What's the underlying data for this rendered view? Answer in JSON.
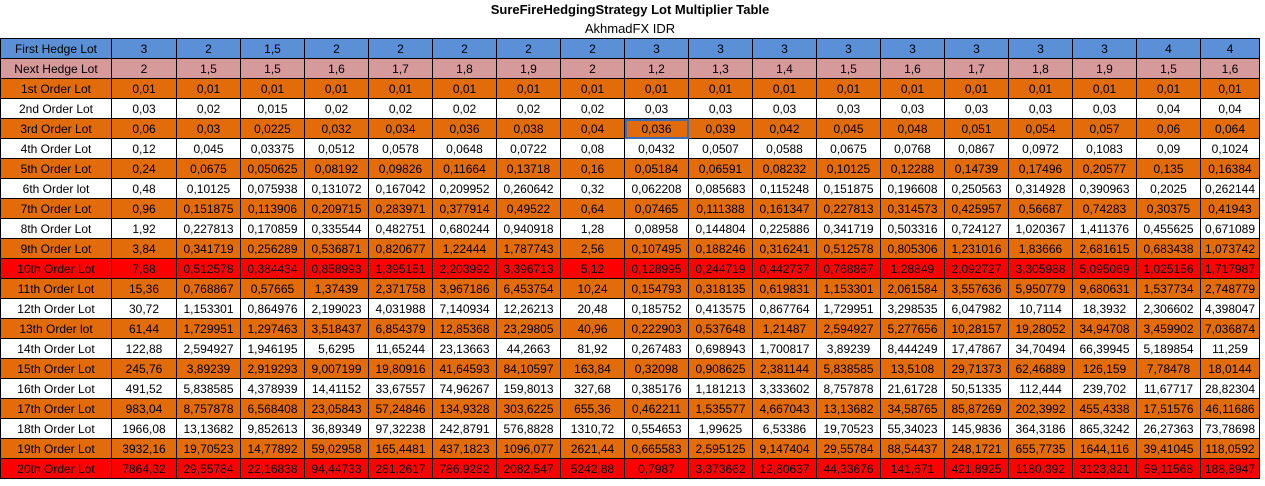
{
  "title": "SureFireHedgingStrategy Lot Multiplier Table",
  "subtitle": "AkhmadFX IDR",
  "rows": [
    {
      "label": "First Hedge Lot",
      "style": "first",
      "values": [
        "3",
        "2",
        "1,5",
        "2",
        "2",
        "2",
        "2",
        "2",
        "3",
        "3",
        "3",
        "3",
        "3",
        "3",
        "3",
        "3",
        "4",
        "4"
      ]
    },
    {
      "label": "Next Hedge Lot",
      "style": "next",
      "values": [
        "2",
        "1,5",
        "1,5",
        "1,6",
        "1,7",
        "1,8",
        "1,9",
        "2",
        "1,2",
        "1,3",
        "1,4",
        "1,5",
        "1,6",
        "1,7",
        "1,8",
        "1,9",
        "1,5",
        "1,6"
      ]
    },
    {
      "label": "1st Order Lot",
      "style": "orange",
      "values": [
        "0,01",
        "0,01",
        "0,01",
        "0,01",
        "0,01",
        "0,01",
        "0,01",
        "0,01",
        "0,01",
        "0,01",
        "0,01",
        "0,01",
        "0,01",
        "0,01",
        "0,01",
        "0,01",
        "0,01",
        "0,01"
      ]
    },
    {
      "label": "2nd Order Lot",
      "style": "white",
      "values": [
        "0,03",
        "0,02",
        "0,015",
        "0,02",
        "0,02",
        "0,02",
        "0,02",
        "0,02",
        "0,03",
        "0,03",
        "0,03",
        "0,03",
        "0,03",
        "0,03",
        "0,03",
        "0,03",
        "0,04",
        "0,04"
      ]
    },
    {
      "label": "3rd Order Lot",
      "style": "orange",
      "values": [
        "0,06",
        "0,03",
        "0,0225",
        "0,032",
        "0,034",
        "0,036",
        "0,038",
        "0,04",
        "0,036",
        "0,039",
        "0,042",
        "0,045",
        "0,048",
        "0,051",
        "0,054",
        "0,057",
        "0,06",
        "0,064"
      ]
    },
    {
      "label": "4th Order Lot",
      "style": "white",
      "values": [
        "0,12",
        "0,045",
        "0,03375",
        "0,0512",
        "0,0578",
        "0,0648",
        "0,0722",
        "0,08",
        "0,0432",
        "0,0507",
        "0,0588",
        "0,0675",
        "0,0768",
        "0,0867",
        "0,0972",
        "0,1083",
        "0,09",
        "0,1024"
      ]
    },
    {
      "label": "5th Order Lot",
      "style": "orange",
      "values": [
        "0,24",
        "0,0675",
        "0,050625",
        "0,08192",
        "0,09826",
        "0,11664",
        "0,13718",
        "0,16",
        "0,05184",
        "0,06591",
        "0,08232",
        "0,10125",
        "0,12288",
        "0,14739",
        "0,17496",
        "0,20577",
        "0,135",
        "0,16384"
      ]
    },
    {
      "label": "6th Order lot",
      "style": "white",
      "values": [
        "0,48",
        "0,10125",
        "0,075938",
        "0,131072",
        "0,167042",
        "0,209952",
        "0,260642",
        "0,32",
        "0,062208",
        "0,085683",
        "0,115248",
        "0,151875",
        "0,196608",
        "0,250563",
        "0,314928",
        "0,390963",
        "0,2025",
        "0,262144"
      ]
    },
    {
      "label": "7th Order Lot",
      "style": "orange",
      "values": [
        "0,96",
        "0,151875",
        "0,113906",
        "0,209715",
        "0,283971",
        "0,377914",
        "0,49522",
        "0,64",
        "0,07465",
        "0,111388",
        "0,161347",
        "0,227813",
        "0,314573",
        "0,425957",
        "0,56687",
        "0,74283",
        "0,30375",
        "0,41943"
      ]
    },
    {
      "label": "8th Order Lot",
      "style": "white",
      "values": [
        "1,92",
        "0,227813",
        "0,170859",
        "0,335544",
        "0,482751",
        "0,680244",
        "0,940918",
        "1,28",
        "0,08958",
        "0,144804",
        "0,225886",
        "0,341719",
        "0,503316",
        "0,724127",
        "1,020367",
        "1,411376",
        "0,455625",
        "0,671089"
      ]
    },
    {
      "label": "9th Order Lot",
      "style": "orange",
      "values": [
        "3,84",
        "0,341719",
        "0,256289",
        "0,536871",
        "0,820677",
        "1,22444",
        "1,787743",
        "2,56",
        "0,107495",
        "0,188246",
        "0,316241",
        "0,512578",
        "0,805306",
        "1,231016",
        "1,83666",
        "2,681615",
        "0,683438",
        "1,073742"
      ]
    },
    {
      "label": "10th Order Lot",
      "style": "red",
      "values": [
        "7,68",
        "0,512578",
        "0,384434",
        "0,858993",
        "1,395151",
        "2,203992",
        "3,396713",
        "5,12",
        "0,128995",
        "0,244719",
        "0,442737",
        "0,768867",
        "1,28849",
        "2,092727",
        "3,305988",
        "5,095069",
        "1,025156",
        "1,717987"
      ]
    },
    {
      "label": "11th Order Lot",
      "style": "orange",
      "values": [
        "15,36",
        "0,768867",
        "0,57665",
        "1,37439",
        "2,371758",
        "3,967186",
        "6,453754",
        "10,24",
        "0,154793",
        "0,318135",
        "0,619831",
        "1,153301",
        "2,061584",
        "3,557636",
        "5,950779",
        "9,680631",
        "1,537734",
        "2,748779"
      ]
    },
    {
      "label": "12th Order Lot",
      "style": "white",
      "values": [
        "30,72",
        "1,153301",
        "0,864976",
        "2,199023",
        "4,031988",
        "7,140934",
        "12,26213",
        "20,48",
        "0,185752",
        "0,413575",
        "0,867764",
        "1,729951",
        "3,298535",
        "6,047982",
        "10,7114",
        "18,3932",
        "2,306602",
        "4,398047"
      ]
    },
    {
      "label": "13th Order lot",
      "style": "orange",
      "values": [
        "61,44",
        "1,729951",
        "1,297463",
        "3,518437",
        "6,854379",
        "12,85368",
        "23,29805",
        "40,96",
        "0,222903",
        "0,537648",
        "1,21487",
        "2,594927",
        "5,277656",
        "10,28157",
        "19,28052",
        "34,94708",
        "3,459902",
        "7,036874"
      ]
    },
    {
      "label": "14th Order Lot",
      "style": "white",
      "values": [
        "122,88",
        "2,594927",
        "1,946195",
        "5,6295",
        "11,65244",
        "23,13663",
        "44,2663",
        "81,92",
        "0,267483",
        "0,698943",
        "1,700817",
        "3,89239",
        "8,444249",
        "17,47867",
        "34,70494",
        "66,39945",
        "5,189854",
        "11,259"
      ]
    },
    {
      "label": "15th Order Lot",
      "style": "orange",
      "values": [
        "245,76",
        "3,89239",
        "2,919293",
        "9,007199",
        "19,80916",
        "41,64593",
        "84,10597",
        "163,84",
        "0,32098",
        "0,908625",
        "2,381144",
        "5,838585",
        "13,5108",
        "29,71373",
        "62,46889",
        "126,159",
        "7,78478",
        "18,0144"
      ]
    },
    {
      "label": "16th Order Lot",
      "style": "white",
      "values": [
        "491,52",
        "5,838585",
        "4,378939",
        "14,41152",
        "33,67557",
        "74,96267",
        "159,8013",
        "327,68",
        "0,385176",
        "1,181213",
        "3,333602",
        "8,757878",
        "21,61728",
        "50,51335",
        "112,444",
        "239,702",
        "11,67717",
        "28,82304"
      ]
    },
    {
      "label": "17th Order Lot",
      "style": "orange",
      "values": [
        "983,04",
        "8,757878",
        "6,568408",
        "23,05843",
        "57,24846",
        "134,9328",
        "303,6225",
        "655,36",
        "0,462211",
        "1,535577",
        "4,667043",
        "13,13682",
        "34,58765",
        "85,87269",
        "202,3992",
        "455,4338",
        "17,51576",
        "46,11686"
      ]
    },
    {
      "label": "18th Order Lot",
      "style": "white",
      "values": [
        "1966,08",
        "13,13682",
        "9,852613",
        "36,89349",
        "97,32238",
        "242,8791",
        "576,8828",
        "1310,72",
        "0,554653",
        "1,99625",
        "6,53386",
        "19,70523",
        "55,34023",
        "145,9836",
        "364,3186",
        "865,3242",
        "26,27363",
        "73,78698"
      ]
    },
    {
      "label": "19th Order Lot",
      "style": "orange",
      "values": [
        "3932,16",
        "19,70523",
        "14,77892",
        "59,02958",
        "165,4481",
        "437,1823",
        "1096,077",
        "2621,44",
        "0,665583",
        "2,595125",
        "9,147404",
        "29,55784",
        "88,54437",
        "248,1721",
        "655,7735",
        "1644,116",
        "39,41045",
        "118,0592"
      ]
    },
    {
      "label": "20th Order Lot",
      "style": "red",
      "values": [
        "7864,32",
        "29,55784",
        "22,16838",
        "94,44733",
        "281,2617",
        "786,9282",
        "2082,547",
        "5242,88",
        "0,7987",
        "3,373662",
        "12,80637",
        "44,33676",
        "141,671",
        "421,8925",
        "1180,392",
        "3123,821",
        "59,11568",
        "188,8947"
      ]
    }
  ]
}
